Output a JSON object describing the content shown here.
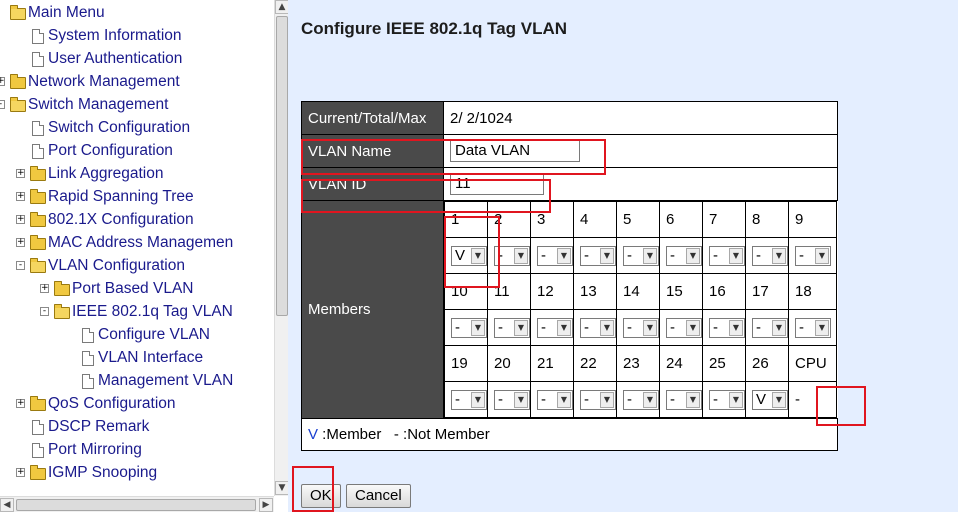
{
  "tree": {
    "items": [
      {
        "label": "Main Menu",
        "type": "folder-open",
        "level": 0
      },
      {
        "label": "System Information",
        "type": "doc",
        "level": 1
      },
      {
        "label": "User Authentication",
        "type": "doc",
        "level": 1
      },
      {
        "label": "Network Management",
        "type": "folder",
        "level": 0,
        "expander": "+"
      },
      {
        "label": "Switch Management",
        "type": "folder-open",
        "level": 0,
        "expander": "-"
      },
      {
        "label": "Switch Configuration",
        "type": "doc",
        "level": 1
      },
      {
        "label": "Port Configuration",
        "type": "doc",
        "level": 1
      },
      {
        "label": "Link Aggregation",
        "type": "folder",
        "level": 1,
        "expander": "+"
      },
      {
        "label": "Rapid Spanning Tree",
        "type": "folder",
        "level": 1,
        "expander": "+"
      },
      {
        "label": "802.1X Configuration",
        "type": "folder",
        "level": 1,
        "expander": "+"
      },
      {
        "label": "MAC Address Managemen",
        "type": "folder",
        "level": 1,
        "expander": "+"
      },
      {
        "label": "VLAN Configuration",
        "type": "folder-open",
        "level": 1,
        "expander": "-"
      },
      {
        "label": "Port Based VLAN",
        "type": "folder",
        "level": 2,
        "expander": "+"
      },
      {
        "label": "IEEE 802.1q Tag VLAN",
        "type": "folder-open",
        "level": 2,
        "expander": "-"
      },
      {
        "label": "Configure VLAN",
        "type": "doc",
        "level": 3
      },
      {
        "label": "VLAN Interface",
        "type": "doc",
        "level": 3
      },
      {
        "label": "Management VLAN",
        "type": "doc",
        "level": 3
      },
      {
        "label": "QoS Configuration",
        "type": "folder",
        "level": 1,
        "expander": "+"
      },
      {
        "label": "DSCP Remark",
        "type": "doc",
        "level": 1
      },
      {
        "label": "Port Mirroring",
        "type": "doc",
        "level": 1
      },
      {
        "label": "IGMP Snooping",
        "type": "folder",
        "level": 1,
        "expander": "+"
      }
    ]
  },
  "main": {
    "title": "Configure IEEE 802.1q Tag VLAN",
    "current_label": "Current/Total/Max",
    "current_value": "2/ 2/1024",
    "vlan_name_label": "VLAN Name",
    "vlan_name_value": "Data VLAN",
    "vlan_id_label": "VLAN ID",
    "vlan_id_value": "11",
    "members_label": "Members",
    "ports": [
      {
        "port": "1",
        "value": "V"
      },
      {
        "port": "2",
        "value": "-"
      },
      {
        "port": "3",
        "value": "-"
      },
      {
        "port": "4",
        "value": "-"
      },
      {
        "port": "5",
        "value": "-"
      },
      {
        "port": "6",
        "value": "-"
      },
      {
        "port": "7",
        "value": "-"
      },
      {
        "port": "8",
        "value": "-"
      },
      {
        "port": "9",
        "value": "-"
      },
      {
        "port": "10",
        "value": "-"
      },
      {
        "port": "11",
        "value": "-"
      },
      {
        "port": "12",
        "value": "-"
      },
      {
        "port": "13",
        "value": "-"
      },
      {
        "port": "14",
        "value": "-"
      },
      {
        "port": "15",
        "value": "-"
      },
      {
        "port": "16",
        "value": "-"
      },
      {
        "port": "17",
        "value": "-"
      },
      {
        "port": "18",
        "value": "-"
      },
      {
        "port": "19",
        "value": "-"
      },
      {
        "port": "20",
        "value": "-"
      },
      {
        "port": "21",
        "value": "-"
      },
      {
        "port": "22",
        "value": "-"
      },
      {
        "port": "23",
        "value": "-"
      },
      {
        "port": "24",
        "value": "-"
      },
      {
        "port": "25",
        "value": "-"
      },
      {
        "port": "26",
        "value": "V"
      },
      {
        "port": "CPU",
        "value": "-",
        "fixed": true
      }
    ],
    "legend_member_symbol": "V",
    "legend_member_text": " :Member",
    "legend_not_symbol": "-",
    "legend_not_text": " :Not Member",
    "ok_label": "OK",
    "cancel_label": "Cancel"
  },
  "colors": {
    "highlight": "#e0151f",
    "header_bg": "#4a4a4a",
    "panel_bg": "#e4eeff",
    "link": "#1a1a8c",
    "member_v": "#1a3fd0"
  }
}
